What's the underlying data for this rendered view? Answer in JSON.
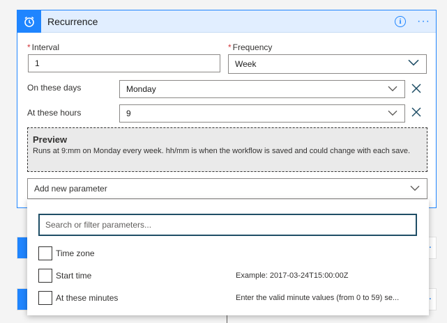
{
  "card": {
    "title": "Recurrence",
    "info_icon": "info-icon",
    "more_icon": "more-options-icon",
    "header_icon": "alarm-clock-icon"
  },
  "fields": {
    "interval": {
      "label": "Interval",
      "value": "1",
      "required": "*"
    },
    "frequency": {
      "label": "Frequency",
      "value": "Week",
      "required": "*"
    },
    "days": {
      "label": "On these days",
      "value": "Monday"
    },
    "hours": {
      "label": "At these hours",
      "value": "9"
    }
  },
  "preview": {
    "title": "Preview",
    "text": "Runs at 9:mm on Monday every week. hh/mm is when the workflow is saved and could change with each save."
  },
  "add_param": {
    "label": "Add new parameter"
  },
  "panel": {
    "search_placeholder": "Search or filter parameters...",
    "options": [
      {
        "label": "Time zone",
        "hint": ""
      },
      {
        "label": "Start time",
        "hint": "Example: 2017-03-24T15:00:00Z"
      },
      {
        "label": "At these minutes",
        "hint": "Enter the valid minute values (from 0 to 59) se..."
      }
    ]
  },
  "colors": {
    "accent": "#1f85ff",
    "header_bg": "#e1eeff",
    "required": "#d13438"
  }
}
